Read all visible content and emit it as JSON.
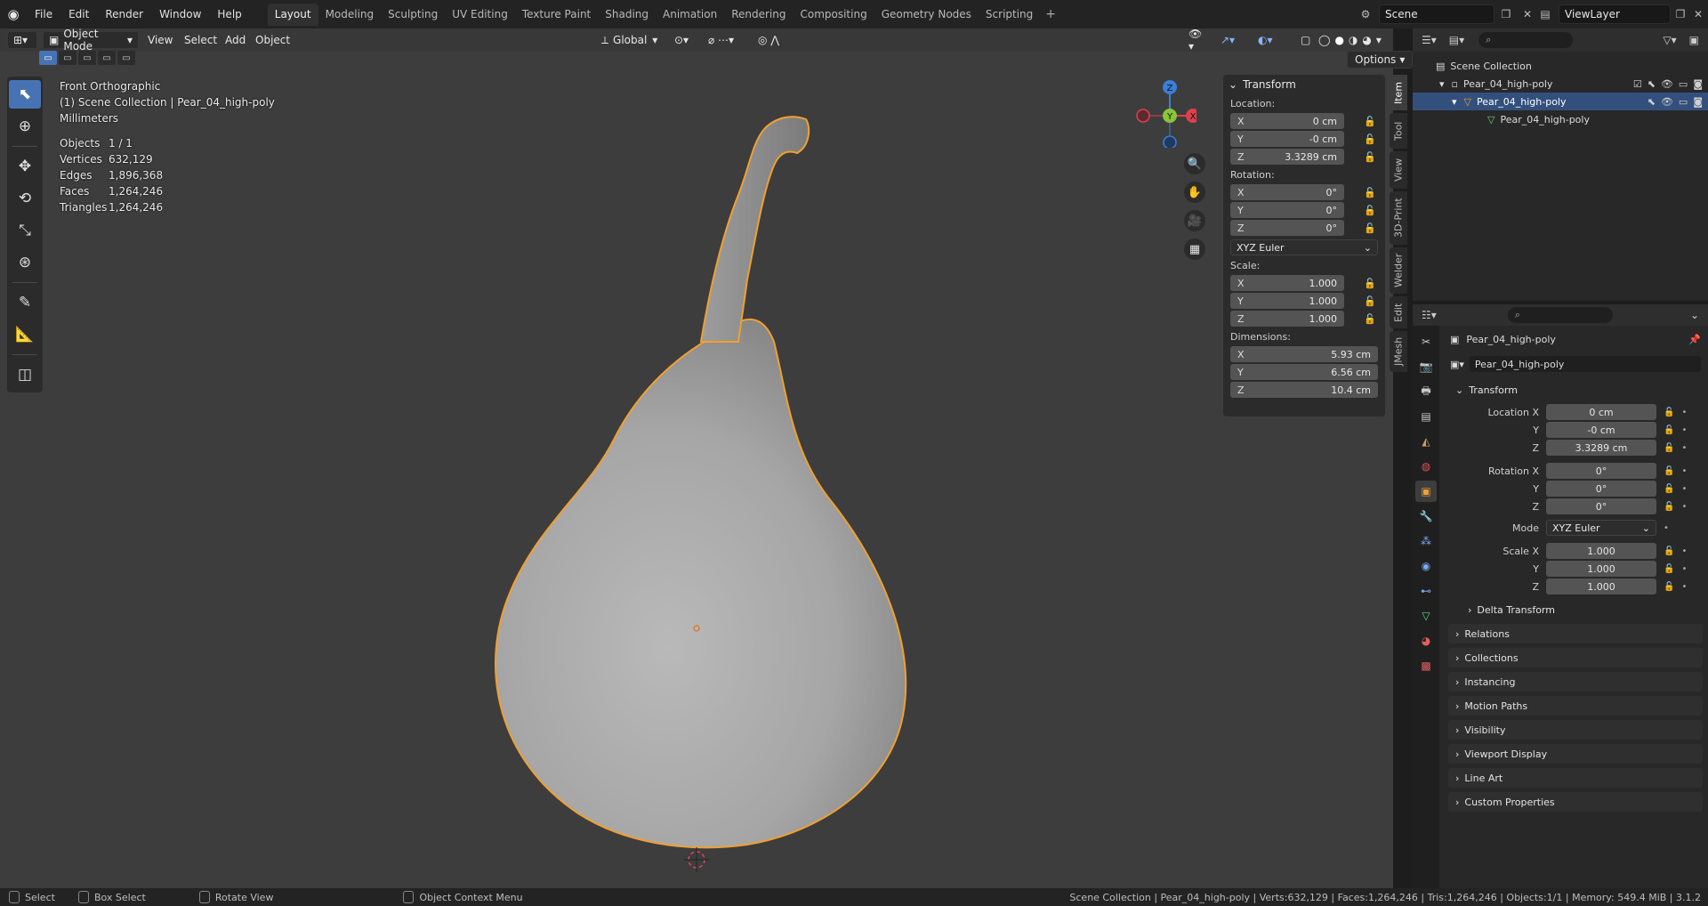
{
  "menus": [
    "File",
    "Edit",
    "Render",
    "Window",
    "Help"
  ],
  "workspaces": [
    "Layout",
    "Modeling",
    "Sculpting",
    "UV Editing",
    "Texture Paint",
    "Shading",
    "Animation",
    "Rendering",
    "Compositing",
    "Geometry Nodes",
    "Scripting"
  ],
  "active_workspace": "Layout",
  "scene": "Scene",
  "view_layer": "ViewLayer",
  "viewport": {
    "mode": "Object Mode",
    "menus": [
      "View",
      "Select",
      "Add",
      "Object"
    ],
    "orientation": "Global",
    "options_label": "Options",
    "view_name": "Front Orthographic",
    "collection_path": "(1) Scene Collection | Pear_04_high-poly",
    "units": "Millimeters",
    "stats": [
      {
        "label": "Objects",
        "value": "1 / 1"
      },
      {
        "label": "Vertices",
        "value": "632,129"
      },
      {
        "label": "Edges",
        "value": "1,896,368"
      },
      {
        "label": "Faces",
        "value": "1,264,246"
      },
      {
        "label": "Triangles",
        "value": "1,264,246"
      }
    ],
    "gizmo_axes": {
      "x": "X",
      "y": "Y",
      "z": "Z"
    }
  },
  "npanel": {
    "title": "Transform",
    "location_label": "Location:",
    "location": [
      {
        "axis": "X",
        "value": "0 cm"
      },
      {
        "axis": "Y",
        "value": "-0 cm"
      },
      {
        "axis": "Z",
        "value": "3.3289 cm"
      }
    ],
    "rotation_label": "Rotation:",
    "rotation": [
      {
        "axis": "X",
        "value": "0°"
      },
      {
        "axis": "Y",
        "value": "0°"
      },
      {
        "axis": "Z",
        "value": "0°"
      }
    ],
    "rotation_mode": "XYZ Euler",
    "scale_label": "Scale:",
    "scale": [
      {
        "axis": "X",
        "value": "1.000"
      },
      {
        "axis": "Y",
        "value": "1.000"
      },
      {
        "axis": "Z",
        "value": "1.000"
      }
    ],
    "dimensions_label": "Dimensions:",
    "dimensions": [
      {
        "axis": "X",
        "value": "5.93 cm"
      },
      {
        "axis": "Y",
        "value": "6.56 cm"
      },
      {
        "axis": "Z",
        "value": "10.4 cm"
      }
    ],
    "tabs": [
      "Item",
      "Tool",
      "View",
      "3D-Print",
      "Welder",
      "Edit",
      "JMesh"
    ]
  },
  "outliner": {
    "root": "Scene Collection",
    "collection": "Pear_04_high-poly",
    "object": "Pear_04_high-poly",
    "mesh": "Pear_04_high-poly"
  },
  "properties": {
    "object_name": "Pear_04_high-poly",
    "datablock": "Pear_04_high-poly",
    "transform_title": "Transform",
    "location": [
      {
        "label": "Location X",
        "value": "0 cm"
      },
      {
        "label": "Y",
        "value": "-0 cm"
      },
      {
        "label": "Z",
        "value": "3.3289 cm"
      }
    ],
    "rotation": [
      {
        "label": "Rotation X",
        "value": "0°"
      },
      {
        "label": "Y",
        "value": "0°"
      },
      {
        "label": "Z",
        "value": "0°"
      }
    ],
    "mode_label": "Mode",
    "mode_value": "XYZ Euler",
    "scale": [
      {
        "label": "Scale X",
        "value": "1.000"
      },
      {
        "label": "Y",
        "value": "1.000"
      },
      {
        "label": "Z",
        "value": "1.000"
      }
    ],
    "delta": "Delta Transform",
    "sections": [
      "Relations",
      "Collections",
      "Instancing",
      "Motion Paths",
      "Visibility",
      "Viewport Display",
      "Line Art",
      "Custom Properties"
    ]
  },
  "statusbar": {
    "select": "Select",
    "box_select": "Box Select",
    "rotate": "Rotate View",
    "context": "Object Context Menu",
    "info": "Scene Collection | Pear_04_high-poly | Verts:632,129 | Faces:1,264,246 | Tris:1,264,246 | Objects:1/1 | Memory: 549.4 MiB | 3.1.2"
  },
  "colors": {
    "selection_outline": "#f0a030",
    "accent": "#4772b3",
    "x_axis": "#e0404c",
    "y_axis": "#8ac43a",
    "z_axis": "#3a7fd8"
  }
}
